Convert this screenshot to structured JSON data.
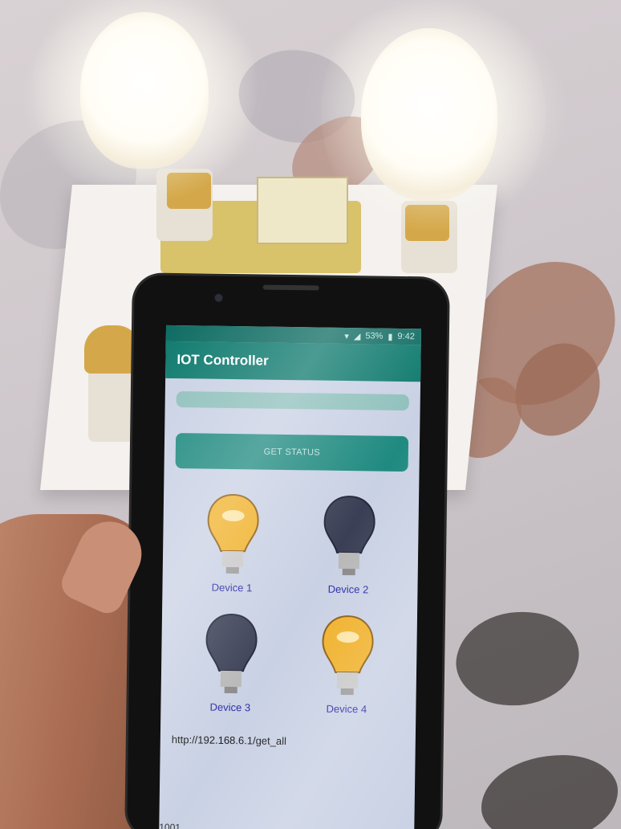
{
  "statusbar": {
    "battery": "53%",
    "time": "9:42",
    "icons": [
      "wifi-icon",
      "signal-icon",
      "battery-icon"
    ]
  },
  "app": {
    "title": "IOT Controller",
    "get_status_label": "GET STATUS",
    "url": "http://192.168.6.1/get_all",
    "counter": "1001"
  },
  "devices": [
    {
      "label": "Device 1",
      "state": "on"
    },
    {
      "label": "Device 2",
      "state": "off"
    },
    {
      "label": "Device 3",
      "state": "off"
    },
    {
      "label": "Device 4",
      "state": "on"
    }
  ],
  "colors": {
    "appbar": "#0f7a6e",
    "statusbar": "#0e6c62",
    "button": "#1f8a80",
    "bulb_on": "#f0b12a",
    "bulb_off": "#3a3f55",
    "device_label": "#2b2aa8"
  }
}
